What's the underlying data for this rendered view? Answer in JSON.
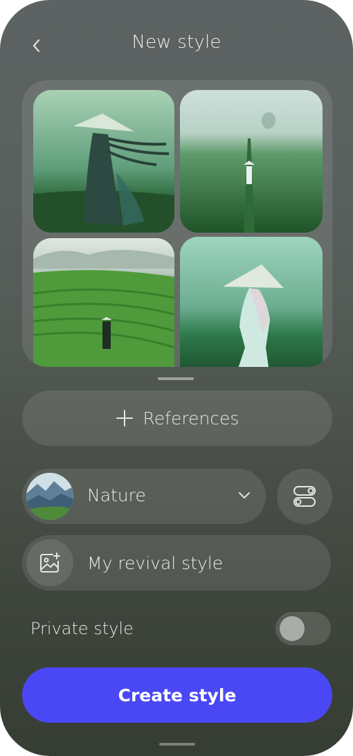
{
  "header": {
    "title": "New style",
    "back_icon": "chevron-left-icon"
  },
  "gallery": {
    "images": [
      {
        "name": "woman-conical-hat-windy-field"
      },
      {
        "name": "figure-walking-misty-rice-field"
      },
      {
        "name": "terraced-rice-hills-figure"
      },
      {
        "name": "woman-conical-hat-back-view"
      }
    ]
  },
  "references": {
    "icon": "plus-icon",
    "label": "References"
  },
  "category": {
    "label": "Nature",
    "dropdown_icon": "chevron-down-icon",
    "settings_icon": "toggles-icon"
  },
  "style_name": {
    "add_image_icon": "add-image-icon",
    "value": "My revival style"
  },
  "private_style": {
    "label": "Private style",
    "enabled": false
  },
  "create_button": {
    "label": "Create style",
    "color": "#4a48f5"
  }
}
